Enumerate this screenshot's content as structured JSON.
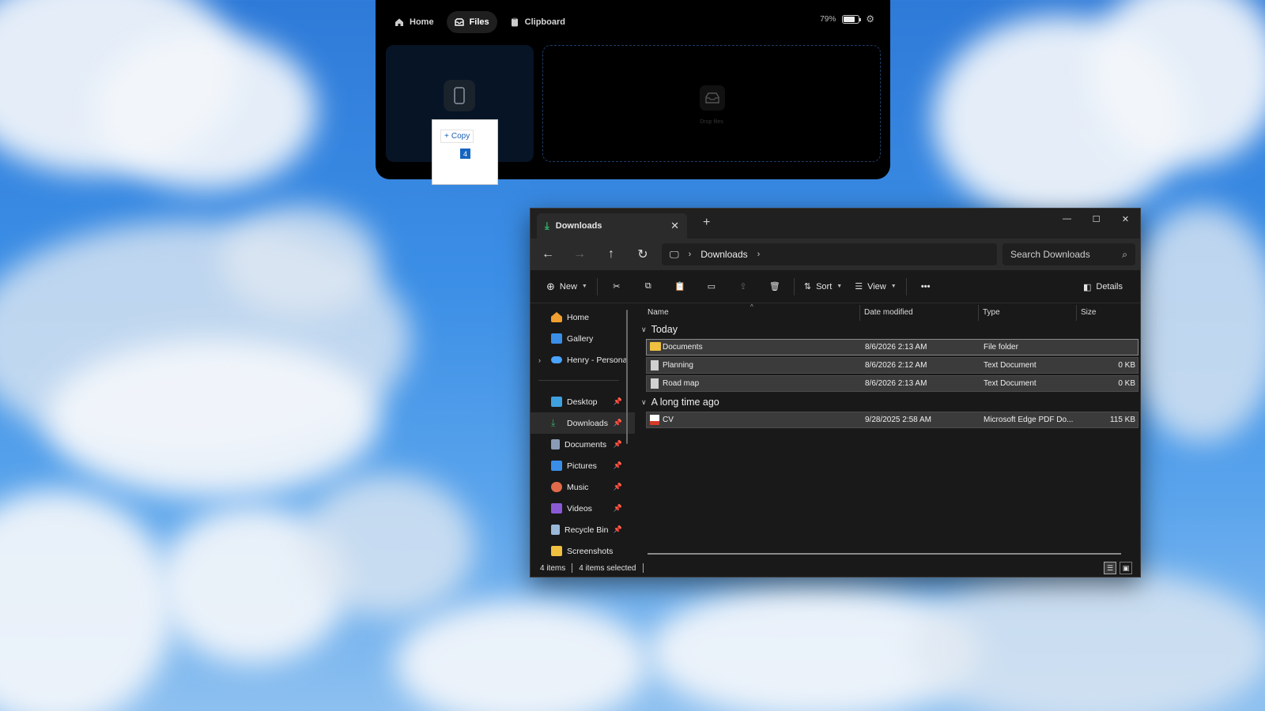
{
  "widget": {
    "tabs": [
      {
        "label": "Home",
        "icon": "home-icon",
        "active": false
      },
      {
        "label": "Files",
        "icon": "files-icon",
        "active": true
      },
      {
        "label": "Clipboard",
        "icon": "clipboard-icon",
        "active": false
      }
    ],
    "battery_percent": "79%",
    "battery_level": 0.79,
    "drop_label": "Drop files"
  },
  "drag_popup": {
    "action": "Copy",
    "count": "4"
  },
  "explorer": {
    "tab_title": "Downloads",
    "breadcrumb": [
      "Downloads"
    ],
    "search_placeholder": "Search Downloads",
    "toolbar": {
      "new_label": "New",
      "sort_label": "Sort",
      "view_label": "View",
      "details_label": "Details"
    },
    "sidebar": {
      "top": [
        {
          "label": "Home",
          "icon": "home-icon",
          "color": "#f0a030"
        },
        {
          "label": "Gallery",
          "icon": "gallery-icon",
          "color": "#3a8ee6"
        },
        {
          "label": "Henry - Persona",
          "icon": "onedrive-icon",
          "color": "#4aa3ff"
        }
      ],
      "pinned": [
        {
          "label": "Desktop",
          "icon": "desktop-icon",
          "color": "#3fa0e0"
        },
        {
          "label": "Downloads",
          "icon": "downloads-icon",
          "color": "#2fb36a",
          "selected": true
        },
        {
          "label": "Documents",
          "icon": "documents-icon",
          "color": "#8a9bb5"
        },
        {
          "label": "Pictures",
          "icon": "pictures-icon",
          "color": "#3a8ee6"
        },
        {
          "label": "Music",
          "icon": "music-icon",
          "color": "#e06a4a"
        },
        {
          "label": "Videos",
          "icon": "videos-icon",
          "color": "#8a5ad6"
        },
        {
          "label": "Recycle Bin",
          "icon": "recycle-bin-icon",
          "color": "#9ab8d8"
        },
        {
          "label": "Screenshots",
          "icon": "folder-icon",
          "color": "#f0c040"
        }
      ]
    },
    "columns": {
      "name": "Name",
      "date": "Date modified",
      "type": "Type",
      "size": "Size"
    },
    "groups": [
      {
        "label": "Today",
        "files": [
          {
            "name": "Documents",
            "date": "8/6/2026 2:13 AM",
            "type": "File folder",
            "size": "",
            "icon": "folder-icon"
          },
          {
            "name": "Planning",
            "date": "8/6/2026 2:12 AM",
            "type": "Text Document",
            "size": "0 KB",
            "icon": "text-file-icon"
          },
          {
            "name": "Road map",
            "date": "8/6/2026 2:13 AM",
            "type": "Text Document",
            "size": "0 KB",
            "icon": "text-file-icon"
          }
        ]
      },
      {
        "label": "A long time ago",
        "files": [
          {
            "name": "CV",
            "date": "9/28/2025 2:58 AM",
            "type": "Microsoft Edge PDF Do...",
            "size": "115 KB",
            "icon": "pdf-icon"
          }
        ]
      }
    ],
    "status": {
      "items": "4 items",
      "selected": "4 items selected"
    }
  }
}
